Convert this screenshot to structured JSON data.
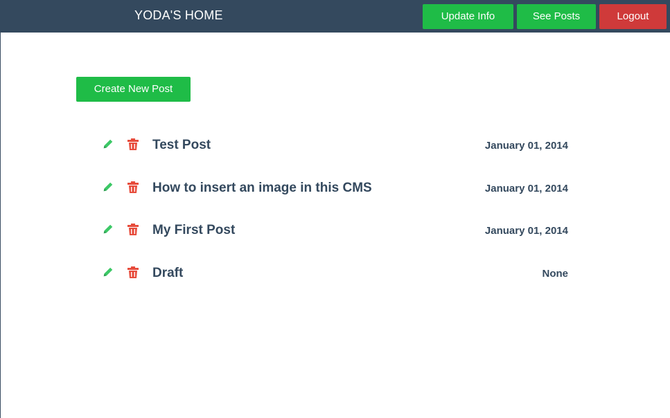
{
  "navbar": {
    "brand": "YODA'S HOME",
    "buttons": [
      {
        "label": "Update Info",
        "color": "#1fbc47"
      },
      {
        "label": "See Posts",
        "color": "#1fbc47"
      },
      {
        "label": "Logout",
        "color": "#cf3a3a"
      }
    ],
    "background": "#34495e"
  },
  "main": {
    "create_label": "Create New Post",
    "posts": [
      {
        "title": "Test Post",
        "date": "January 01, 2014",
        "edit_icon": "pencil-icon",
        "delete_icon": "trash-icon"
      },
      {
        "title": "How to insert an image in this CMS",
        "date": "January 01, 2014",
        "edit_icon": "pencil-icon",
        "delete_icon": "trash-icon"
      },
      {
        "title": "My First Post",
        "date": "January 01, 2014",
        "edit_icon": "pencil-icon",
        "delete_icon": "trash-icon"
      },
      {
        "title": "Draft",
        "date": "None",
        "edit_icon": "pencil-icon",
        "delete_icon": "trash-icon"
      }
    ]
  },
  "colors": {
    "accent_green": "#1fbc47",
    "danger_red": "#cf3a3a",
    "text_dark": "#34495e",
    "icon_green": "#3cc866",
    "icon_red": "#e74c3c"
  }
}
